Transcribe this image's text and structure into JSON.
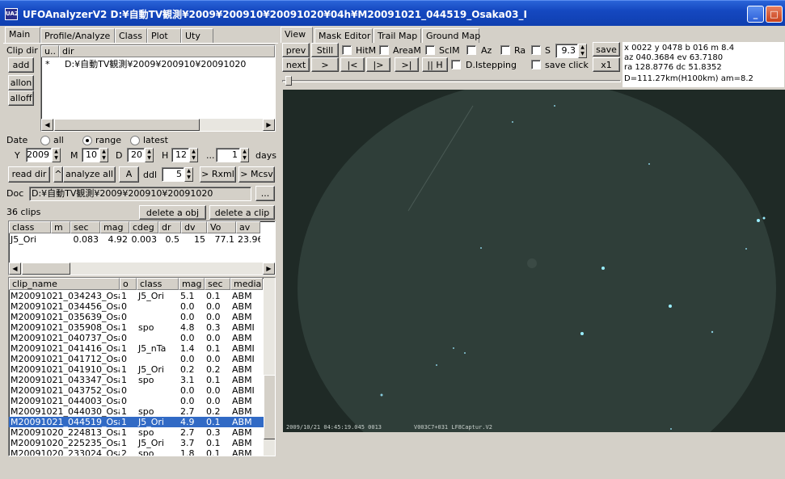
{
  "window": {
    "title": "UFOAnalyzerV2  D:¥自動TV観測¥2009¥200910¥20091020¥04h¥M20091021_044519_Osaka03_I",
    "icon_text": "UA2",
    "buttons": [
      "minimize-icon",
      "maximize-icon",
      "close-icon"
    ]
  },
  "left_tabs": [
    "Main",
    "Profile/Analyze",
    "Class",
    "Plot",
    "Uty"
  ],
  "clipdir": {
    "label": "Clip dir",
    "add": "add",
    "allon": "allon",
    "alloff": "alloff",
    "col_u": "u..",
    "col_dir": "dir",
    "row_mark": "*",
    "row_dir": "D:¥自動TV観測¥2009¥200910¥20091020"
  },
  "date": {
    "label": "Date",
    "opt_all": "all",
    "opt_range": "range",
    "opt_latest": "latest",
    "y_label": "Y",
    "year": "2009",
    "m_label": "M",
    "month": "10",
    "d_label": "D",
    "day": "20",
    "h_label": "H",
    "hour": "12",
    "ellipsis": "...",
    "days_value": "1",
    "days_label": "days"
  },
  "actions": {
    "read_dir": "read dir",
    "caret": "^",
    "analyze_all": "analyze all",
    "a": "A",
    "ddl_label": "ddl",
    "ddl_value": "5",
    "rxml": "> Rxml",
    "mcsv": "> Mcsv"
  },
  "doc": {
    "label": "Doc",
    "value": "D:¥自動TV観測¥2009¥200910¥20091020",
    "browse": "..."
  },
  "clips": {
    "count": "36 clips",
    "delete_obj": "delete a obj",
    "delete_clip": "delete a clip"
  },
  "obj_table": {
    "headers": [
      "class",
      "m",
      "sec",
      "mag",
      "cdeg",
      "dr",
      "dv",
      "Vo",
      "av"
    ],
    "rows": [
      [
        "J5_Ori",
        "",
        "0.083",
        "4.92",
        "0.003",
        "0.5",
        "15",
        "77.1",
        "23.96"
      ]
    ]
  },
  "clip_table": {
    "headers": [
      "clip_name",
      "o",
      "class",
      "mag",
      "sec",
      "media"
    ],
    "rows": [
      [
        "M20091021_034243_Osa...",
        "1",
        "J5_Ori",
        "5.1",
        "0.1",
        "ABM"
      ],
      [
        "M20091021_034456_Osa...",
        "0",
        "",
        "0.0",
        "0.0",
        "ABM"
      ],
      [
        "M20091021_035639_Osa...",
        "0",
        "",
        "0.0",
        "0.0",
        "ABM"
      ],
      [
        "M20091021_035908_Osa...",
        "1",
        "spo",
        "4.8",
        "0.3",
        "ABMI"
      ],
      [
        "M20091021_040737_Osa...",
        "0",
        "",
        "0.0",
        "0.0",
        "ABM"
      ],
      [
        "M20091021_041416_Osa...",
        "1",
        "J5_nTa",
        "1.4",
        "0.1",
        "ABMI"
      ],
      [
        "M20091021_041712_Osa...",
        "0",
        "",
        "0.0",
        "0.0",
        "ABMI"
      ],
      [
        "M20091021_041910_Osa...",
        "1",
        "J5_Ori",
        "0.2",
        "0.2",
        "ABM"
      ],
      [
        "M20091021_043347_Osa...",
        "1",
        "spo",
        "3.1",
        "0.1",
        "ABM"
      ],
      [
        "M20091021_043752_Osa...",
        "0",
        "",
        "0.0",
        "0.0",
        "ABMI"
      ],
      [
        "M20091021_044003_Osa...",
        "0",
        "",
        "0.0",
        "0.0",
        "ABM"
      ],
      [
        "M20091021_044030_Osa...",
        "1",
        "spo",
        "2.7",
        "0.2",
        "ABM"
      ],
      [
        "M20091021_044519_Osa...",
        "1",
        "J5_Ori",
        "4.9",
        "0.1",
        "ABM"
      ],
      [
        "M20091020_224813_Osa...",
        "1",
        "spo",
        "2.7",
        "0.3",
        "ABM"
      ],
      [
        "M20091020_225235_Osa...",
        "1",
        "J5_Ori",
        "3.7",
        "0.1",
        "ABM"
      ],
      [
        "M20091020_233024_Osa...",
        "2",
        "spo",
        "1.8",
        "0.1",
        "ABM"
      ]
    ]
  },
  "right_tabs": [
    "View",
    "Mask Editor",
    "Trail Map",
    "Ground Map"
  ],
  "view": {
    "prev": "prev",
    "next": "next",
    "still": "Still",
    "hitm": "HitM",
    "aream": "AreaM",
    "sclm": "SclM",
    "az": "Az",
    "ra": "Ra",
    "s": "S",
    "s_value": "9.3",
    "save": "save",
    "x1": "x1",
    "play": ">",
    "first": "|<",
    "fwd": "|>",
    "end": ">|",
    "pause": "|| H",
    "dstepping": "D.Istepping",
    "save_click": "save click"
  },
  "info": {
    "line1": "x 0022  y 0478  b 016  m 8.4",
    "line2": "az 040.3684  ev 63.7180",
    "line3": "ra 128.8776  dc 51.8352",
    "line4": "D=111.27km(H100km) am=8.2"
  },
  "overlay": {
    "timestamp": "2009/10/21 04:45:19.045 0013",
    "label": "V003C7+031 LF8Captur.V2"
  },
  "colors": {
    "title_bar": "#1548c0",
    "selection": "#316ac5",
    "sky": "#1f2a26",
    "dome": "#2f3e39"
  }
}
